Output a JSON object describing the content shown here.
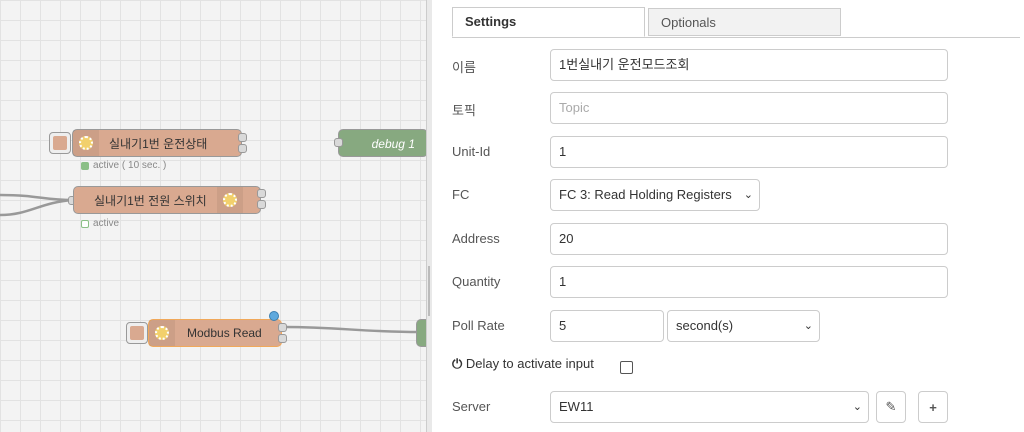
{
  "canvas": {
    "nodes": {
      "status_node": {
        "label": "실내기1번 운전상태",
        "status": "active ( 10 sec. )"
      },
      "debug_node": {
        "label": "debug 1"
      },
      "switch_node": {
        "label": "실내기1번 전원 스위치",
        "status": "active"
      },
      "modbus_node": {
        "label": "Modbus Read"
      }
    },
    "colors": {
      "node_fill": "#d9a990",
      "debug_fill": "#87a980",
      "status_green": "#8bbf86",
      "selected_dot": "#5fa9dd"
    }
  },
  "panel": {
    "tabs": [
      {
        "label": "Settings",
        "active": true
      },
      {
        "label": "Optionals",
        "active": false
      }
    ],
    "fields": {
      "name": {
        "label": "이름",
        "value": "1번실내기 운전모드조회"
      },
      "topic": {
        "label": "토픽",
        "placeholder": "Topic"
      },
      "unit_id": {
        "label": "Unit-Id",
        "value": "1"
      },
      "fc": {
        "label": "FC",
        "value": "FC 3: Read Holding Registers"
      },
      "address": {
        "label": "Address",
        "value": "20"
      },
      "quantity": {
        "label": "Quantity",
        "value": "1"
      },
      "poll_rate": {
        "label": "Poll Rate",
        "value": "5",
        "unit": "second(s)"
      },
      "delay": {
        "label": "Delay to activate input",
        "checked": false
      },
      "server": {
        "label": "Server",
        "value": "EW11"
      }
    },
    "icons": {
      "chevron": "chevron-down-icon",
      "edit": "pencil-icon",
      "add": "plus-icon",
      "power": "power-icon"
    }
  }
}
